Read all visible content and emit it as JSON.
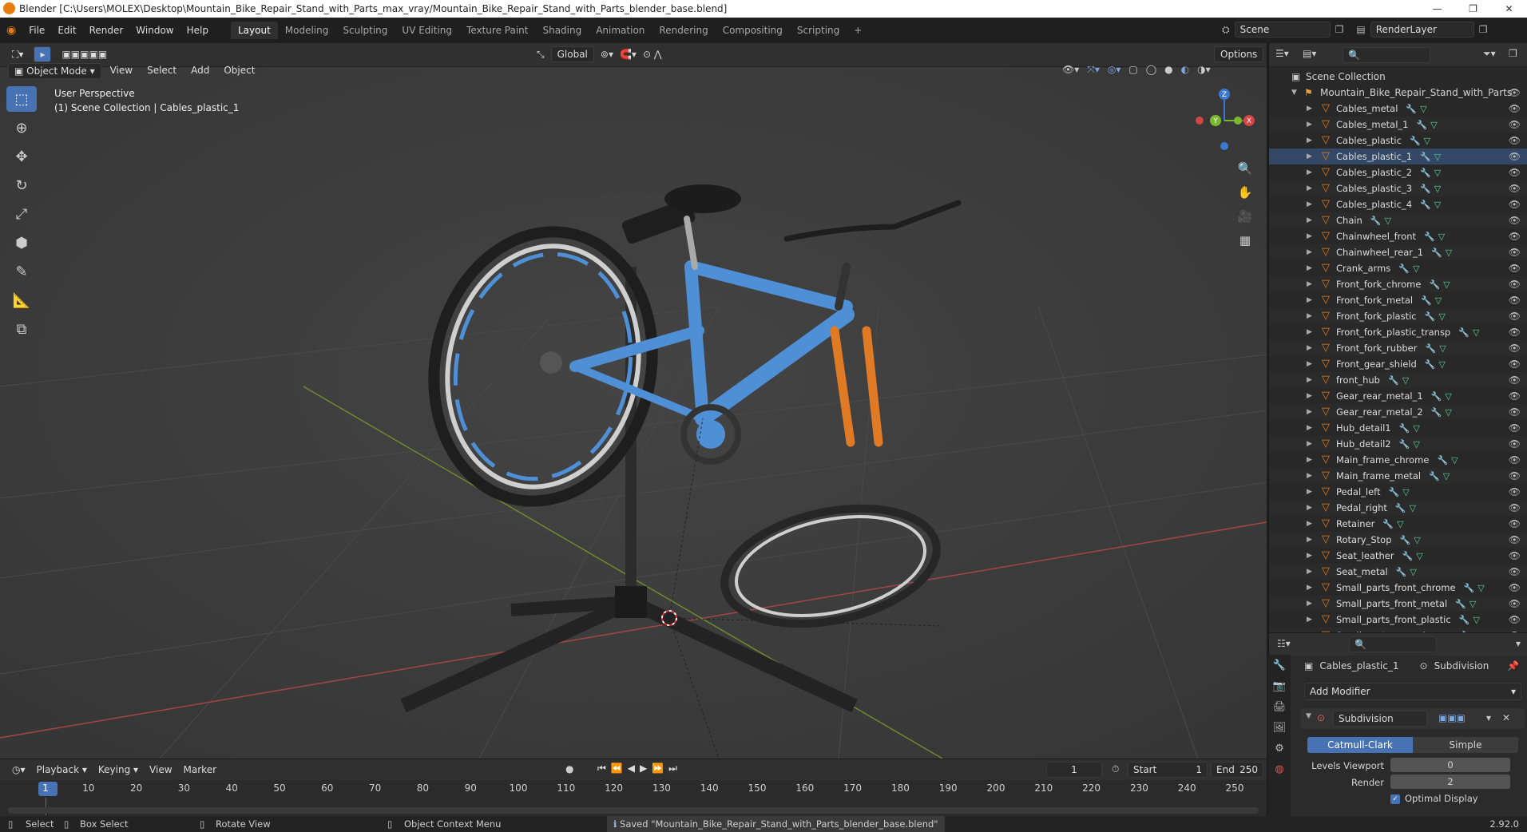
{
  "window": {
    "title": "Blender [C:\\Users\\MOLEX\\Desktop\\Mountain_Bike_Repair_Stand_with_Parts_max_vray/Mountain_Bike_Repair_Stand_with_Parts_blender_base.blend]"
  },
  "menu": [
    "File",
    "Edit",
    "Render",
    "Window",
    "Help"
  ],
  "workspaces": [
    "Layout",
    "Modeling",
    "Sculpting",
    "UV Editing",
    "Texture Paint",
    "Shading",
    "Animation",
    "Rendering",
    "Compositing",
    "Scripting"
  ],
  "active_workspace": "Layout",
  "scene": "Scene",
  "renderlayer": "RenderLayer",
  "viewport_header": {
    "transform": "Global",
    "options": "Options",
    "mode": "Object Mode",
    "menus": [
      "View",
      "Select",
      "Add",
      "Object"
    ]
  },
  "overlay_text": {
    "perspective": "User Perspective",
    "collection": "(1) Scene Collection | Cables_plastic_1"
  },
  "gizmo": {
    "z": "Z",
    "y": "Y",
    "x": "X"
  },
  "outliner": {
    "root": "Scene Collection",
    "collection": "Mountain_Bike_Repair_Stand_with_Parts",
    "items": [
      "Cables_metal",
      "Cables_metal_1",
      "Cables_plastic",
      "Cables_plastic_1",
      "Cables_plastic_2",
      "Cables_plastic_3",
      "Cables_plastic_4",
      "Chain",
      "Chainwheel_front",
      "Chainwheel_rear_1",
      "Crank_arms",
      "Front_fork_chrome",
      "Front_fork_metal",
      "Front_fork_plastic",
      "Front_fork_plastic_transp",
      "Front_fork_rubber",
      "Front_gear_shield",
      "front_hub",
      "Gear_rear_metal_1",
      "Gear_rear_metal_2",
      "Hub_detail1",
      "Hub_detail2",
      "Main_frame_chrome",
      "Main_frame_metal",
      "Pedal_left",
      "Pedal_right",
      "Retainer",
      "Rotary_Stop",
      "Seat_leather",
      "Seat_metal",
      "Small_parts_front_chrome",
      "Small_parts_front_metal",
      "Small_parts_front_plastic",
      "Small_parts_rear_chrome"
    ]
  },
  "properties": {
    "object": "Cables_plastic_1",
    "modifier_tab": "Subdivision",
    "add_modifier": "Add Modifier",
    "modifier_name": "Subdivision",
    "mode_a": "Catmull-Clark",
    "mode_b": "Simple",
    "levels_label": "Levels Viewport",
    "levels_value": "0",
    "render_label": "Render",
    "render_value": "2",
    "optimal": "Optimal Display"
  },
  "timeline": {
    "menus": [
      "Playback",
      "Keying",
      "View",
      "Marker"
    ],
    "current_frame": "1",
    "start_label": "Start",
    "start": "1",
    "end_label": "End",
    "end": "250",
    "ticks": [
      "1",
      "10",
      "20",
      "30",
      "40",
      "50",
      "60",
      "70",
      "80",
      "90",
      "100",
      "110",
      "120",
      "130",
      "140",
      "150",
      "160",
      "170",
      "180",
      "190",
      "200",
      "210",
      "220",
      "230",
      "240",
      "250"
    ]
  },
  "status": {
    "select": "Select",
    "box_select": "Box Select",
    "rotate": "Rotate View",
    "context": "Object Context Menu",
    "message": "Saved \"Mountain_Bike_Repair_Stand_with_Parts_blender_base.blend\"",
    "version": "2.92.0"
  },
  "colors": {
    "accent": "#4772b3",
    "orange": "#e87d0d",
    "bike_blue": "#4f8fd6"
  }
}
